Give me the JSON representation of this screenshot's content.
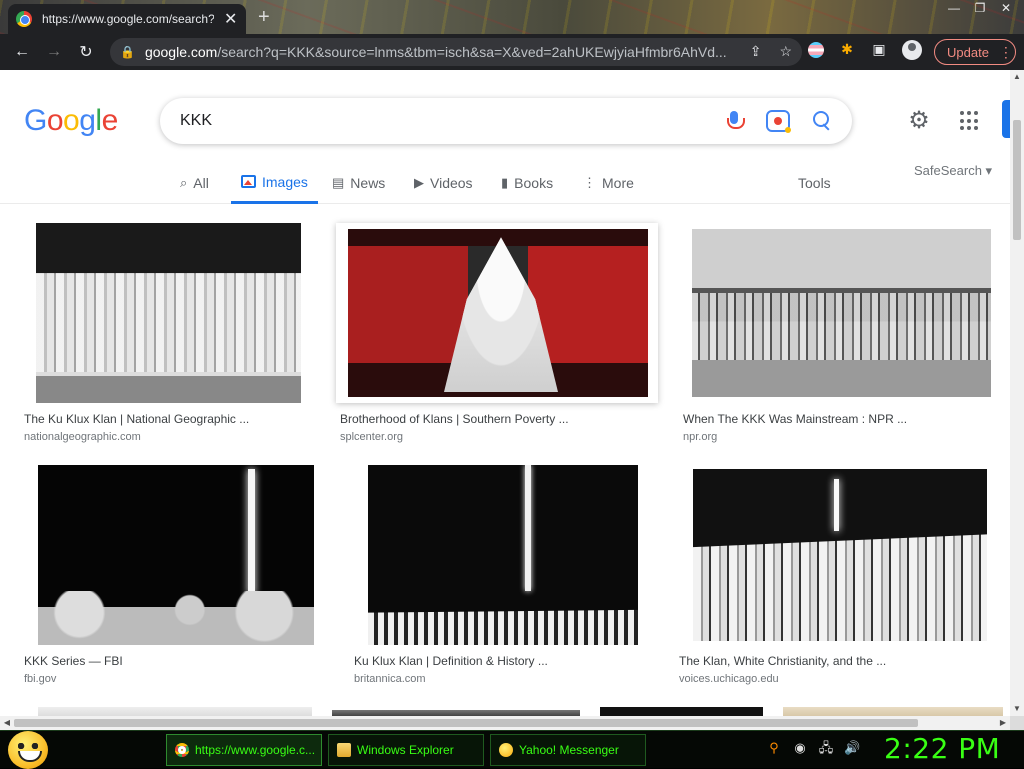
{
  "browser": {
    "tab_title": "https://www.google.com/search?q=KKK&source=lnms",
    "tab_close": "✕",
    "new_tab": "+",
    "window_controls": [
      "—",
      "❐",
      "✕"
    ],
    "back": "←",
    "forward": "→",
    "reload": "↻",
    "url_host": "google.com",
    "url_rest": "/search?q=KKK&source=lnms&tbm=isch&sa=X&ved=2ahUKEwjyiaHfmbr6AhVd...",
    "share_icon": "⇪",
    "bookmark_icon": "☆",
    "extensions_icon": "✱",
    "sidepanel_icon": "▣",
    "update_label": "Update",
    "menu_dots": "⋮"
  },
  "google": {
    "logo": {
      "g1": "G",
      "o1": "o",
      "o2": "o",
      "g2": "g",
      "l": "l",
      "e": "e"
    },
    "query": "KKK",
    "settings_icon": "⚙",
    "tabs": [
      {
        "label": "All",
        "icon": "⌕"
      },
      {
        "label": "Images",
        "icon": ""
      },
      {
        "label": "News",
        "icon": "▤"
      },
      {
        "label": "Videos",
        "icon": "▶"
      },
      {
        "label": "Books",
        "icon": "▮"
      },
      {
        "label": "More",
        "icon": "⋮"
      }
    ],
    "tools": "Tools",
    "safesearch": "SafeSearch ▾"
  },
  "results": [
    {
      "title": "The Ku Klux Klan | National Geographic ...",
      "source": "nationalgeographic.com"
    },
    {
      "title": "Brotherhood of Klans | Southern Poverty ...",
      "source": "splcenter.org"
    },
    {
      "title": "When The KKK Was Mainstream : NPR ...",
      "source": "npr.org"
    },
    {
      "title": "KKK Series — FBI",
      "source": "fbi.gov"
    },
    {
      "title": "Ku Klux Klan | Definition & History ...",
      "source": "britannica.com"
    },
    {
      "title": "The Klan, White Christianity, and the ...",
      "source": "voices.uchicago.edu"
    }
  ],
  "scroll": {
    "up": "▲",
    "down": "▼",
    "left": "◀",
    "right": "▶"
  },
  "taskbar": {
    "tasks": [
      {
        "label": "https://www.google.c...",
        "icon": "chrome-icon"
      },
      {
        "label": "Windows Explorer",
        "icon": "folder-icon"
      },
      {
        "label": "Yahoo! Messenger",
        "icon": "yahoo-smiley-icon"
      }
    ],
    "tray": [
      "⚲",
      "◉",
      "🖧",
      "🔊"
    ],
    "clock": "2:22 PM"
  },
  "colors": {
    "accent": "#1a73e8",
    "taskbar_text": "#39ff14",
    "update": "#f28b82"
  }
}
